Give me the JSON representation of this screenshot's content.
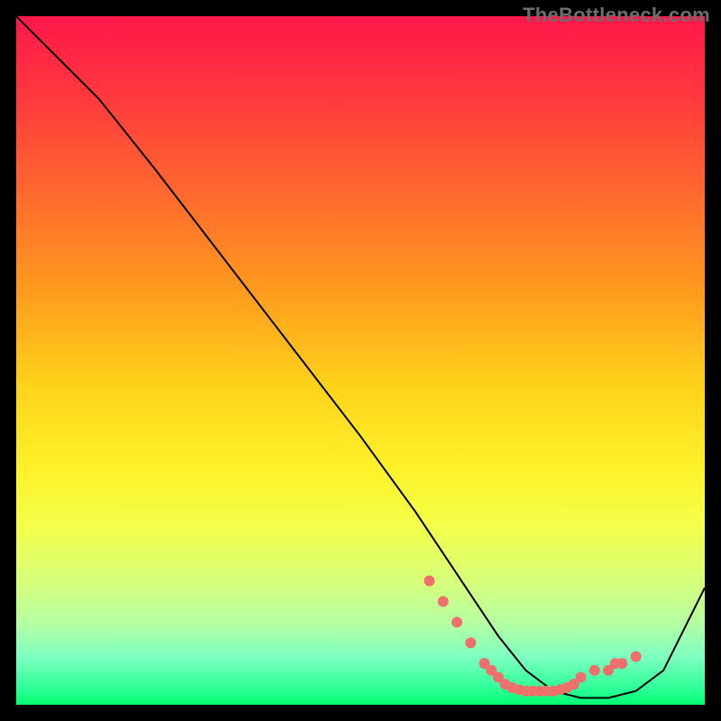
{
  "watermark": "TheBottleneck.com",
  "chart_data": {
    "type": "line",
    "title": "",
    "xlabel": "",
    "ylabel": "",
    "xlim": [
      0,
      100
    ],
    "ylim": [
      0,
      100
    ],
    "grid": false,
    "series": [
      {
        "name": "curve",
        "color": "#000000",
        "x": [
          0,
          8,
          12,
          20,
          30,
          40,
          50,
          58,
          62,
          66,
          70,
          74,
          78,
          82,
          86,
          90,
          94,
          100
        ],
        "y": [
          100,
          92,
          88,
          78,
          65,
          52,
          39,
          28,
          22,
          16,
          10,
          5,
          2,
          1,
          1,
          2,
          5,
          17
        ]
      }
    ],
    "markers": [
      {
        "name": "bottom-dots",
        "color": "#ef6f6c",
        "radius_px": 6,
        "x": [
          60,
          62,
          64,
          66,
          68,
          69,
          70,
          71,
          72,
          73,
          74,
          75,
          76,
          77,
          78,
          79,
          80,
          81,
          82,
          84,
          86,
          87,
          88,
          90
        ],
        "y": [
          18,
          15,
          12,
          9,
          6,
          5,
          4,
          3,
          2.5,
          2.2,
          2,
          2,
          2,
          2,
          2,
          2.2,
          2.5,
          3,
          4,
          5,
          5,
          6,
          6,
          7
        ]
      }
    ],
    "background_gradient": {
      "top": "#ff174b",
      "bottom": "#00ff6e"
    }
  }
}
